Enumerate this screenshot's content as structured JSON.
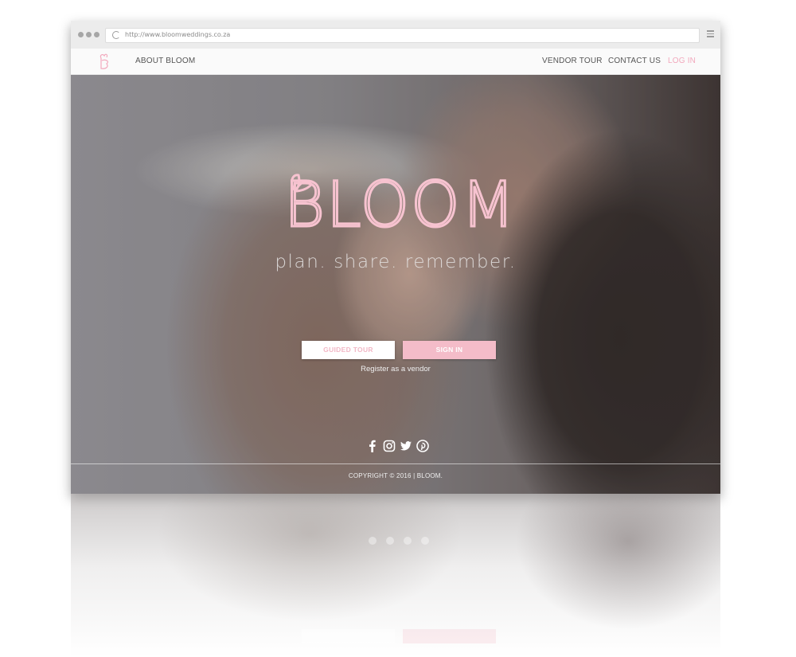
{
  "browser": {
    "url": "http://www.bloomweddings.co.za"
  },
  "nav": {
    "about": "ABOUT BLOOM",
    "vendor_tour": "VENDOR TOUR",
    "contact_us": "CONTACT US",
    "log_in": "LOG IN"
  },
  "hero": {
    "brand": "BLOOM",
    "tagline": "plan. share. remember.",
    "guided_tour_label": "GUIDED TOUR",
    "sign_in_label": "SIGN IN",
    "register_link": "Register as a vendor",
    "social_icons": [
      "facebook-icon",
      "instagram-icon",
      "twitter-icon",
      "pinterest-icon"
    ]
  },
  "footer": {
    "copyright": "COPYRIGHT © 2016  |  BLOOM."
  },
  "colors": {
    "accent_pink": "#f4bcc9",
    "link_pink": "#f2a9bd",
    "nav_text": "#555555"
  }
}
